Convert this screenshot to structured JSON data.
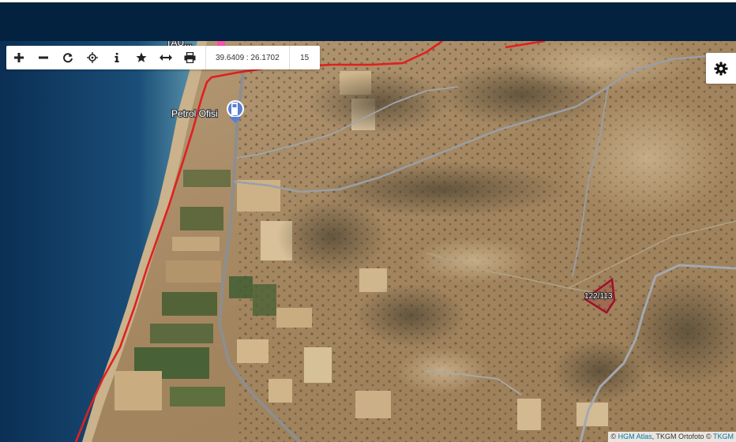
{
  "toolbar": {
    "coordinates": "39.6409 : 26.1702",
    "zoom_level": "15",
    "buttons": [
      {
        "icon": "zoom-in-icon"
      },
      {
        "icon": "zoom-out-icon"
      },
      {
        "icon": "refresh-icon"
      },
      {
        "icon": "locate-icon"
      },
      {
        "icon": "info-icon"
      },
      {
        "icon": "star-icon"
      },
      {
        "icon": "measure-icon"
      },
      {
        "icon": "print-icon"
      }
    ]
  },
  "map": {
    "poi": {
      "label": "Petrol Ofisi",
      "icon": "fuel-station-icon"
    },
    "parcel": {
      "label": "122/113",
      "outline_color": "#a0102a"
    },
    "boundary_color": "#e02020",
    "top_label_fragment": "TAU..."
  },
  "attribution": {
    "prefix": "© ",
    "link1": "HGM Atlas",
    "middle": ", TKGM Ortofoto © ",
    "link2": "TKGM"
  },
  "settings": {
    "icon": "gear-icon"
  },
  "colors": {
    "header": "#02223f",
    "sea_deep": "#0d3a63",
    "sea_shallow": "#5d94ad",
    "land": "#a98a65"
  }
}
